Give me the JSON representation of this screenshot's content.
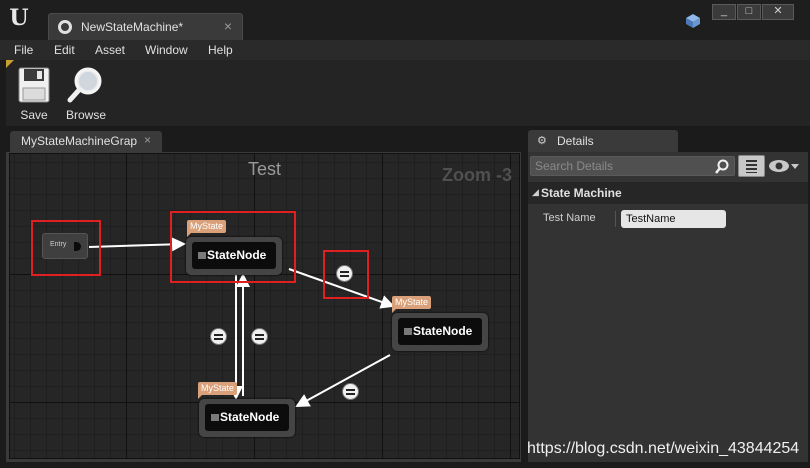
{
  "window": {
    "tab_title": "NewStateMachine*",
    "tab_close": "×",
    "minimize": "_",
    "maximize": "□",
    "close": "✕"
  },
  "menu": [
    "File",
    "Edit",
    "Asset",
    "Window",
    "Help"
  ],
  "toolbar": {
    "save_label": "Save",
    "browse_label": "Browse"
  },
  "graph_tab": {
    "label": "MyStateMachineGrap",
    "close": "×"
  },
  "graph": {
    "title": "Test",
    "zoom": "Zoom -3",
    "entry_label": "Entry",
    "states": [
      {
        "tag": "MyState",
        "label": "StateNode"
      },
      {
        "tag": "MyState",
        "label": "StateNode"
      },
      {
        "tag": "MyState",
        "label": "StateNode"
      }
    ]
  },
  "details": {
    "tab_label": "Details",
    "search_placeholder": "Search Details",
    "category": "State Machine",
    "properties": [
      {
        "label": "Test Name",
        "value": "TestName"
      }
    ]
  },
  "watermark": "https://blog.csdn.net/weixin_43844254",
  "colors": {
    "highlight": "#e02020",
    "state_tag": "#d9a07a",
    "graph_bg": "#262626"
  }
}
